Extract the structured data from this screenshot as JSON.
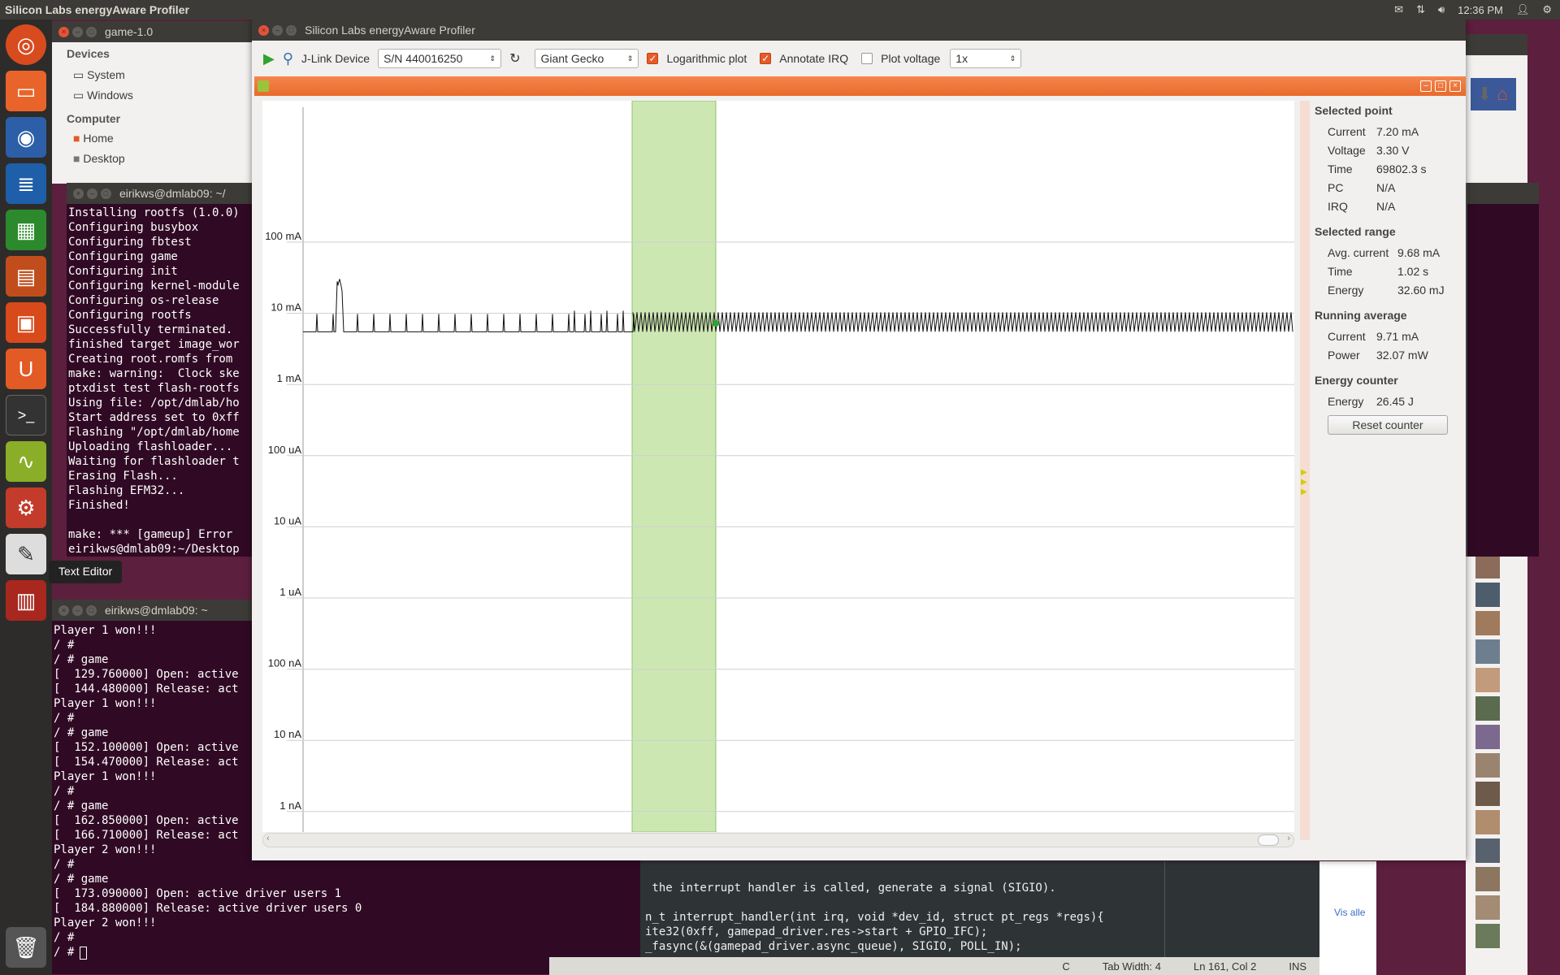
{
  "top_panel": {
    "title": "Silicon Labs energyAware Profiler",
    "time": "12:36 PM"
  },
  "launcher": {
    "tooltip": "Text Editor"
  },
  "files_window": {
    "title": "game-1.0",
    "devices_label": "Devices",
    "devices": [
      "System",
      "Windows"
    ],
    "computer_label": "Computer",
    "computer": [
      "Home",
      "Desktop"
    ]
  },
  "terminal1": {
    "title": "eirikws@dmlab09: ~/",
    "lines": [
      "Installing rootfs (1.0.0)",
      "Configuring busybox",
      "Configuring fbtest",
      "Configuring game",
      "Configuring init",
      "Configuring kernel-module",
      "Configuring os-release",
      "Configuring rootfs",
      "Successfully terminated.",
      "finished target image_wor",
      "Creating root.romfs from ",
      "make: warning:  Clock ske",
      "ptxdist test flash-rootfs",
      "Using file: /opt/dmlab/ho",
      "Start address set to 0xff",
      "Flashing \"/opt/dmlab/home",
      "Uploading flashloader...",
      "Waiting for flashloader t",
      "Erasing Flash...",
      "Flashing EFM32...",
      "Finished!",
      "",
      "make: *** [gameup] Error ",
      "eirikws@dmlab09:~/Desktop"
    ]
  },
  "terminal2": {
    "title": "eirikws@dmlab09: ~",
    "lines": [
      "Player 1 won!!!",
      "/ #",
      "/ # game",
      "[  129.760000] Open: active",
      "[  144.480000] Release: act",
      "Player 1 won!!!",
      "/ #",
      "/ # game",
      "[  152.100000] Open: active",
      "[  154.470000] Release: act",
      "Player 1 won!!!",
      "/ #",
      "/ # game",
      "[  162.850000] Open: active",
      "[  166.710000] Release: act",
      "Player 2 won!!!",
      "/ #",
      "/ # game",
      "[  173.090000] Open: active driver users 1",
      "[  184.880000] Release: active driver users 0",
      "Player 2 won!!!",
      "/ #",
      "/ # "
    ]
  },
  "editor": {
    "lines": [
      " the interrupt handler is called, generate a signal (SIGIO).",
      "",
      "n_t interrupt_handler(int irq, void *dev_id, struct pt_regs *regs){",
      "ite32(0xff, gamepad_driver.res->start + GPIO_IFC);",
      "_fasync(&(gamepad_driver.async_queue), SIGIO, POLL_IN);"
    ],
    "status": {
      "lang": "C",
      "tab_width": "Tab Width: 4",
      "position": "Ln 161, Col 2",
      "mode": "INS"
    }
  },
  "chat": {
    "see_all": "Vis alle"
  },
  "profiler": {
    "title": "Silicon Labs energyAware Profiler",
    "jlink_label": "J-Link Device",
    "device_serial": "S/N 440016250",
    "target": "Giant Gecko",
    "log_plot_label": "Logarithmic plot",
    "log_plot_checked": true,
    "annotate_irq_label": "Annotate IRQ",
    "annotate_irq_checked": true,
    "plot_voltage_label": "Plot voltage",
    "plot_voltage_checked": false,
    "zoom": "1x",
    "accent": "#e86a2a",
    "selected_point": {
      "heading": "Selected point",
      "current_label": "Current",
      "current": "7.20 mA",
      "voltage_label": "Voltage",
      "voltage": "3.30 V",
      "time_label": "Time",
      "time": "69802.3 s",
      "pc_label": "PC",
      "pc": "N/A",
      "irq_label": "IRQ",
      "irq": "N/A"
    },
    "selected_range": {
      "heading": "Selected range",
      "avg_label": "Avg. current",
      "avg": "9.68 mA",
      "time_label": "Time",
      "time": "1.02 s",
      "energy_label": "Energy",
      "energy": "32.60 mJ"
    },
    "running_average": {
      "heading": "Running average",
      "current_label": "Current",
      "current": "9.71 mA",
      "power_label": "Power",
      "power": "32.07 mW"
    },
    "energy_counter": {
      "heading": "Energy counter",
      "energy_label": "Energy",
      "energy": "26.45 J",
      "reset_label": "Reset counter"
    }
  },
  "chart_data": {
    "type": "line",
    "yscale": "log",
    "ytick_labels": [
      "100 mA",
      "10 mA",
      "1 mA",
      "100 uA",
      "10 uA",
      "1 uA",
      "100 nA",
      "10 nA",
      "1 nA"
    ],
    "ytick_values_A": [
      0.1,
      0.01,
      0.001,
      0.0001,
      1e-05,
      1e-06,
      1e-07,
      1e-08,
      1e-09
    ],
    "ylim_A": [
      1e-09,
      0.1
    ],
    "grid": true,
    "series": [
      {
        "baseline_A": 0.0055,
        "pulse_peak_A": 0.0098,
        "burst_peak_A": 0.028,
        "selected_point_A": 0.0072
      }
    ],
    "selection": {
      "avg_current_A": 0.00968,
      "duration_s": 1.02
    },
    "selection_color": "#cde7b3"
  }
}
